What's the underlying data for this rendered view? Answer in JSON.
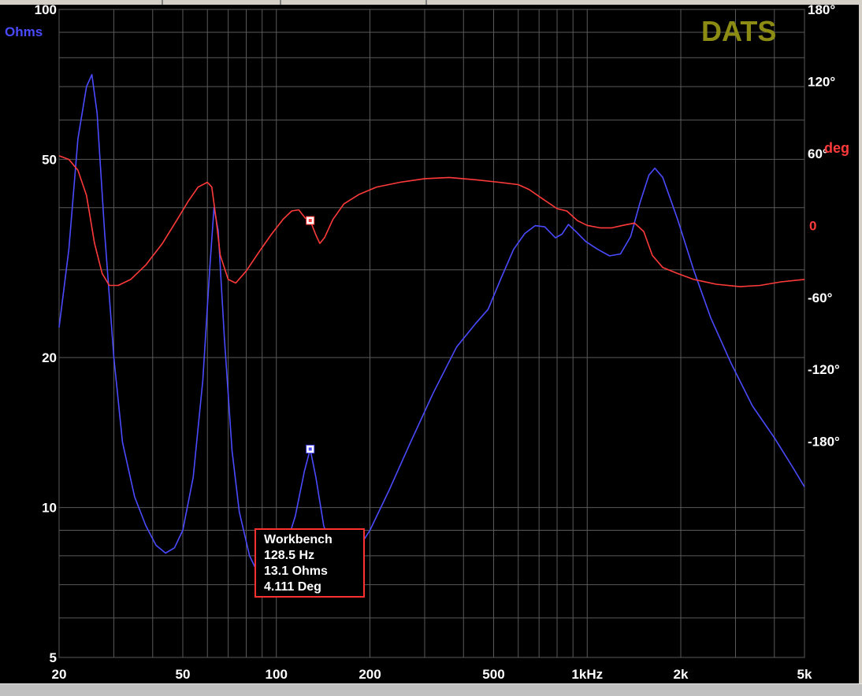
{
  "brand": "DATS",
  "colors": {
    "background": "#000000",
    "grid": "#5a5a5a",
    "impedance": "#4a4aff",
    "phase": "#ff3a3a",
    "brand": "#8c8c14",
    "tick_text": "#ffffff",
    "cursor_box_border": "#ff3030"
  },
  "cursor": {
    "lines": [
      "Workbench",
      "128.5 Hz",
      "13.1 Ohms",
      "4.111 Deg"
    ]
  },
  "chart_data": {
    "type": "line",
    "x_scale": "log",
    "xlim": [
      20,
      5000
    ],
    "x_ticks": [
      {
        "value": 20,
        "label": "20"
      },
      {
        "value": 50,
        "label": "50"
      },
      {
        "value": 100,
        "label": "100"
      },
      {
        "value": 200,
        "label": "200"
      },
      {
        "value": 500,
        "label": "500"
      },
      {
        "value": 1000,
        "label": "1kHz"
      },
      {
        "value": 2000,
        "label": "2k"
      },
      {
        "value": 5000,
        "label": "5k"
      }
    ],
    "y_left": {
      "label": "Ohms",
      "scale": "log",
      "lim": [
        5,
        100
      ],
      "ticks": [
        {
          "value": 100,
          "label": "100"
        },
        {
          "value": 50,
          "label": "50"
        },
        {
          "value": 20,
          "label": "20"
        },
        {
          "value": 10,
          "label": "10"
        },
        {
          "value": 5,
          "label": "5"
        }
      ]
    },
    "y_right": {
      "label": "deg",
      "scale": "linear",
      "lim": [
        -360,
        180
      ],
      "ticks": [
        {
          "value": 180,
          "label": "180°"
        },
        {
          "value": 120,
          "label": "120°"
        },
        {
          "value": 60,
          "label": "60°"
        },
        {
          "value": 0,
          "label": "0"
        },
        {
          "value": -60,
          "label": "-60°"
        },
        {
          "value": -120,
          "label": "-120°"
        },
        {
          "value": -180,
          "label": "-180°"
        }
      ]
    },
    "grid": true,
    "series": [
      {
        "axis": "left",
        "color": "#4a4aff",
        "points": [
          [
            20,
            23
          ],
          [
            21.5,
            33
          ],
          [
            23,
            55
          ],
          [
            24.5,
            70
          ],
          [
            25.5,
            74
          ],
          [
            26.5,
            62
          ],
          [
            28,
            36
          ],
          [
            30,
            20
          ],
          [
            32,
            13.5
          ],
          [
            35,
            10.5
          ],
          [
            38,
            9.2
          ],
          [
            41,
            8.4
          ],
          [
            44,
            8.1
          ],
          [
            47,
            8.3
          ],
          [
            50,
            9
          ],
          [
            54,
            11.5
          ],
          [
            58,
            18
          ],
          [
            61,
            30
          ],
          [
            63,
            40
          ],
          [
            65,
            36
          ],
          [
            68,
            22
          ],
          [
            72,
            13
          ],
          [
            76,
            9.8
          ],
          [
            82,
            8.0
          ],
          [
            88,
            7.3
          ],
          [
            95,
            7.2
          ],
          [
            105,
            8.0
          ],
          [
            115,
            9.6
          ],
          [
            123,
            11.8
          ],
          [
            128.5,
            13.1
          ],
          [
            134,
            11.5
          ],
          [
            142,
            9.2
          ],
          [
            155,
            7.8
          ],
          [
            175,
            7.9
          ],
          [
            200,
            9.0
          ],
          [
            230,
            10.8
          ],
          [
            270,
            13.5
          ],
          [
            320,
            17
          ],
          [
            380,
            21
          ],
          [
            440,
            23.5
          ],
          [
            480,
            25
          ],
          [
            530,
            29
          ],
          [
            580,
            33
          ],
          [
            630,
            35.5
          ],
          [
            680,
            36.8
          ],
          [
            730,
            36.6
          ],
          [
            790,
            34.8
          ],
          [
            830,
            35.4
          ],
          [
            870,
            37
          ],
          [
            920,
            35.8
          ],
          [
            990,
            34.2
          ],
          [
            1080,
            33
          ],
          [
            1180,
            32
          ],
          [
            1280,
            32.3
          ],
          [
            1380,
            35
          ],
          [
            1480,
            41
          ],
          [
            1580,
            46.5
          ],
          [
            1650,
            48
          ],
          [
            1750,
            46
          ],
          [
            1950,
            38
          ],
          [
            2200,
            30
          ],
          [
            2500,
            24
          ],
          [
            2900,
            19.5
          ],
          [
            3400,
            16
          ],
          [
            4000,
            13.8
          ],
          [
            4600,
            12
          ],
          [
            5000,
            11
          ]
        ]
      },
      {
        "axis": "right",
        "color": "#ff3a3a",
        "points": [
          [
            20,
            58
          ],
          [
            21.5,
            55
          ],
          [
            23,
            46
          ],
          [
            24.5,
            25
          ],
          [
            26,
            -15
          ],
          [
            27.5,
            -40
          ],
          [
            29,
            -50
          ],
          [
            31,
            -50
          ],
          [
            34,
            -45
          ],
          [
            38,
            -33
          ],
          [
            43,
            -15
          ],
          [
            48,
            5
          ],
          [
            52,
            20
          ],
          [
            56,
            32
          ],
          [
            60,
            36
          ],
          [
            62,
            32
          ],
          [
            64,
            5
          ],
          [
            66,
            -25
          ],
          [
            70,
            -45
          ],
          [
            74,
            -48
          ],
          [
            80,
            -38
          ],
          [
            88,
            -22
          ],
          [
            96,
            -8
          ],
          [
            105,
            5
          ],
          [
            112,
            12
          ],
          [
            118,
            13
          ],
          [
            124,
            6
          ],
          [
            128.5,
            4.1
          ],
          [
            134,
            -8
          ],
          [
            138,
            -15
          ],
          [
            143,
            -10
          ],
          [
            152,
            5
          ],
          [
            165,
            18
          ],
          [
            185,
            26
          ],
          [
            210,
            32
          ],
          [
            250,
            36
          ],
          [
            300,
            39
          ],
          [
            360,
            40
          ],
          [
            440,
            38
          ],
          [
            520,
            36
          ],
          [
            600,
            34
          ],
          [
            650,
            30
          ],
          [
            720,
            22
          ],
          [
            800,
            14
          ],
          [
            860,
            12
          ],
          [
            930,
            4
          ],
          [
            1000,
            0
          ],
          [
            1100,
            -2
          ],
          [
            1200,
            -2
          ],
          [
            1300,
            0
          ],
          [
            1420,
            2
          ],
          [
            1520,
            -5
          ],
          [
            1620,
            -25
          ],
          [
            1750,
            -35
          ],
          [
            1950,
            -40
          ],
          [
            2200,
            -45
          ],
          [
            2600,
            -49
          ],
          [
            3100,
            -51
          ],
          [
            3600,
            -50
          ],
          [
            4200,
            -47
          ],
          [
            5000,
            -45
          ]
        ]
      }
    ],
    "cursor_point": {
      "x": 128.5,
      "y_left": 13.1,
      "y_right": 4.111
    }
  }
}
